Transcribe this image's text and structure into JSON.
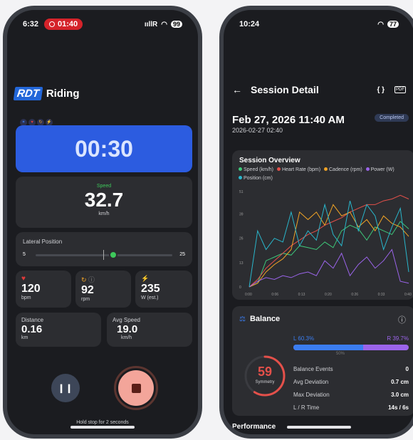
{
  "left": {
    "status": {
      "time": "6:32",
      "rec_time": "01:40",
      "signal": "ııllR",
      "battery": "99"
    },
    "header": {
      "logo": "RDT",
      "title": "Riding"
    },
    "timer": "00:30",
    "speed": {
      "label": "Speed",
      "value": "32.7",
      "unit": "km/h"
    },
    "lateral": {
      "label": "Lateral Position",
      "min": "5",
      "max": "25",
      "level_fraction": 0.57
    },
    "heart": {
      "value": "120",
      "unit": "bpm"
    },
    "cadence": {
      "value": "92",
      "unit": "rpm"
    },
    "power": {
      "value": "235",
      "unit": "W (est.)"
    },
    "distance": {
      "label": "Distance",
      "value": "0.16",
      "unit": "km"
    },
    "avg_speed": {
      "label": "Avg Speed",
      "value": "19.0",
      "unit": "km/h"
    },
    "hint": "Hold stop for 2 seconds",
    "colors": {
      "accent": "#2c5ce0",
      "stop": "#f3a59a",
      "green": "#3ec85b"
    }
  },
  "right": {
    "status": {
      "time": "10:24",
      "battery": "77"
    },
    "header": {
      "title": "Session Detail"
    },
    "date": "Feb 27, 2026 11:40 AM",
    "subdate": "2026-02-27 02:40",
    "badge": "Completed",
    "chart_data": {
      "type": "line",
      "title": "Session Overview",
      "x_labels": [
        "0:00",
        "0:06",
        "0:13",
        "0:20",
        "0:26",
        "0:33",
        "0:40"
      ],
      "y_labels": [
        "51",
        "39",
        "26",
        "13",
        "0"
      ],
      "ylim": [
        0,
        51
      ],
      "series": [
        {
          "name": "Speed (km/h)",
          "color": "#3ec87a",
          "values": [
            0,
            2,
            14,
            16,
            18,
            17,
            22,
            21,
            20,
            24,
            21,
            30,
            33,
            31,
            25,
            32,
            30,
            28,
            35,
            31
          ]
        },
        {
          "name": "Heart Rate (bpm)",
          "color": "#e4504a",
          "values": [
            0,
            4,
            10,
            14,
            18,
            22,
            25,
            28,
            30,
            33,
            35,
            37,
            40,
            42,
            44,
            44,
            46,
            47,
            49,
            47
          ]
        },
        {
          "name": "Cadence (rpm)",
          "color": "#f0a326",
          "values": [
            0,
            2,
            8,
            12,
            15,
            20,
            40,
            36,
            40,
            33,
            44,
            38,
            40,
            32,
            36,
            30,
            38,
            34,
            32,
            27
          ]
        },
        {
          "name": "Power (W)",
          "color": "#9b64ea",
          "values": [
            0,
            3,
            5,
            4,
            6,
            5,
            7,
            8,
            6,
            14,
            10,
            18,
            6,
            12,
            16,
            10,
            14,
            20,
            3,
            2
          ]
        },
        {
          "name": "Position (cm)",
          "color": "#29b7cc",
          "values": [
            0,
            30,
            20,
            26,
            24,
            40,
            22,
            30,
            25,
            44,
            28,
            22,
            46,
            30,
            44,
            38,
            20,
            32,
            42,
            8
          ]
        }
      ]
    },
    "balance": {
      "title": "Balance",
      "left": "L 60.3%",
      "right": "R 39.7%",
      "left_fraction": 0.603,
      "mid": "50%",
      "score": "59",
      "score_label": "Symmetry",
      "score_fraction": 0.59,
      "rows": [
        {
          "label": "Balance Events",
          "value": "0"
        },
        {
          "label": "Avg Deviation",
          "value": "0.7 cm"
        },
        {
          "label": "Max Deviation",
          "value": "3.0 cm"
        },
        {
          "label": "L / R Time",
          "value": "14s / 6s"
        }
      ]
    },
    "performance": "Performance"
  }
}
